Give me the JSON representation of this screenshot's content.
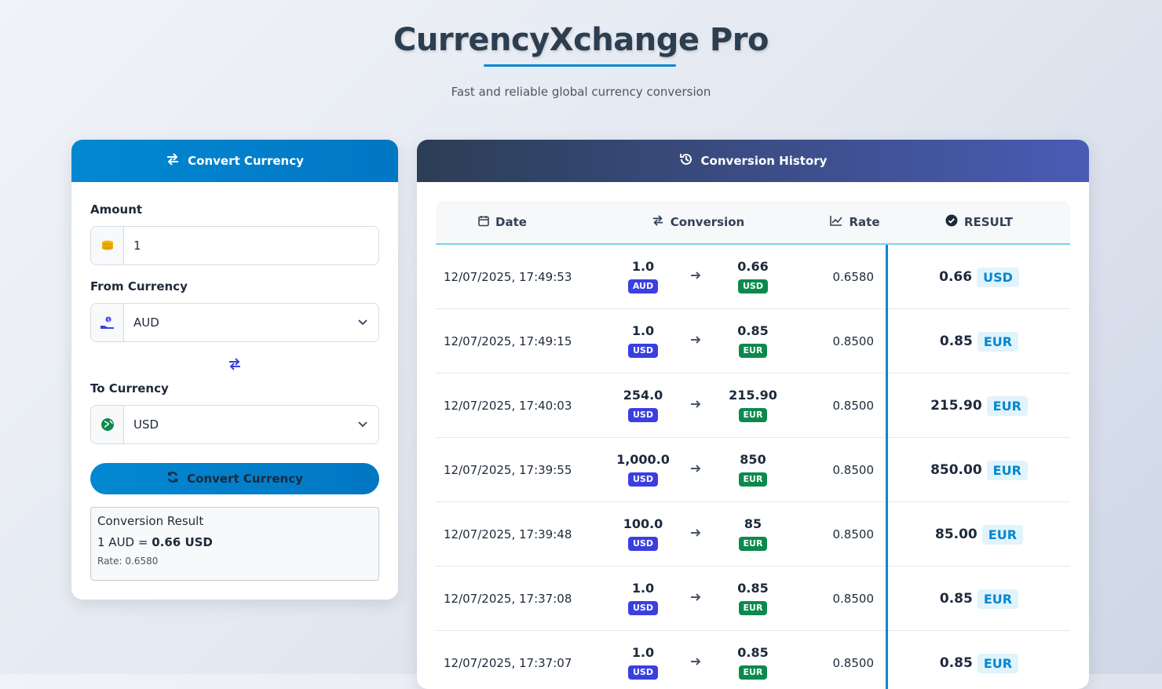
{
  "header": {
    "title": "CurrencyXchange Pro",
    "subtitle": "Fast and reliable global currency conversion"
  },
  "converter": {
    "header_label": "Convert Currency",
    "amount_label": "Amount",
    "amount_value": "1",
    "from_label": "From Currency",
    "from_value": "AUD",
    "to_label": "To Currency",
    "to_value": "USD",
    "button_label": "Convert Currency",
    "result": {
      "title": "Conversion Result",
      "prefix": "1 AUD = ",
      "value": "0.66 USD",
      "rate": "Rate: 0.6580"
    }
  },
  "history": {
    "header_label": "Conversion History",
    "columns": {
      "date": "Date",
      "conversion": "Conversion",
      "rate": "Rate",
      "result": "RESULT"
    },
    "rows": [
      {
        "date": "12/07/2025, 17:49:53",
        "from_amt": "1.0",
        "from_cur": "AUD",
        "to_amt": "0.66",
        "to_cur": "USD",
        "rate": "0.6580",
        "result": "0.66",
        "result_cur": "USD"
      },
      {
        "date": "12/07/2025, 17:49:15",
        "from_amt": "1.0",
        "from_cur": "USD",
        "to_amt": "0.85",
        "to_cur": "EUR",
        "rate": "0.8500",
        "result": "0.85",
        "result_cur": "EUR"
      },
      {
        "date": "12/07/2025, 17:40:03",
        "from_amt": "254.0",
        "from_cur": "USD",
        "to_amt": "215.90",
        "to_cur": "EUR",
        "rate": "0.8500",
        "result": "215.90",
        "result_cur": "EUR"
      },
      {
        "date": "12/07/2025, 17:39:55",
        "from_amt": "1,000.0",
        "from_cur": "USD",
        "to_amt": "850",
        "to_cur": "EUR",
        "rate": "0.8500",
        "result": "850.00",
        "result_cur": "EUR"
      },
      {
        "date": "12/07/2025, 17:39:48",
        "from_amt": "100.0",
        "from_cur": "USD",
        "to_amt": "85",
        "to_cur": "EUR",
        "rate": "0.8500",
        "result": "85.00",
        "result_cur": "EUR"
      },
      {
        "date": "12/07/2025, 17:37:08",
        "from_amt": "1.0",
        "from_cur": "USD",
        "to_amt": "0.85",
        "to_cur": "EUR",
        "rate": "0.8500",
        "result": "0.85",
        "result_cur": "EUR"
      },
      {
        "date": "12/07/2025, 17:37:07",
        "from_amt": "1.0",
        "from_cur": "USD",
        "to_amt": "0.85",
        "to_cur": "EUR",
        "rate": "0.8500",
        "result": "0.85",
        "result_cur": "EUR"
      }
    ]
  }
}
